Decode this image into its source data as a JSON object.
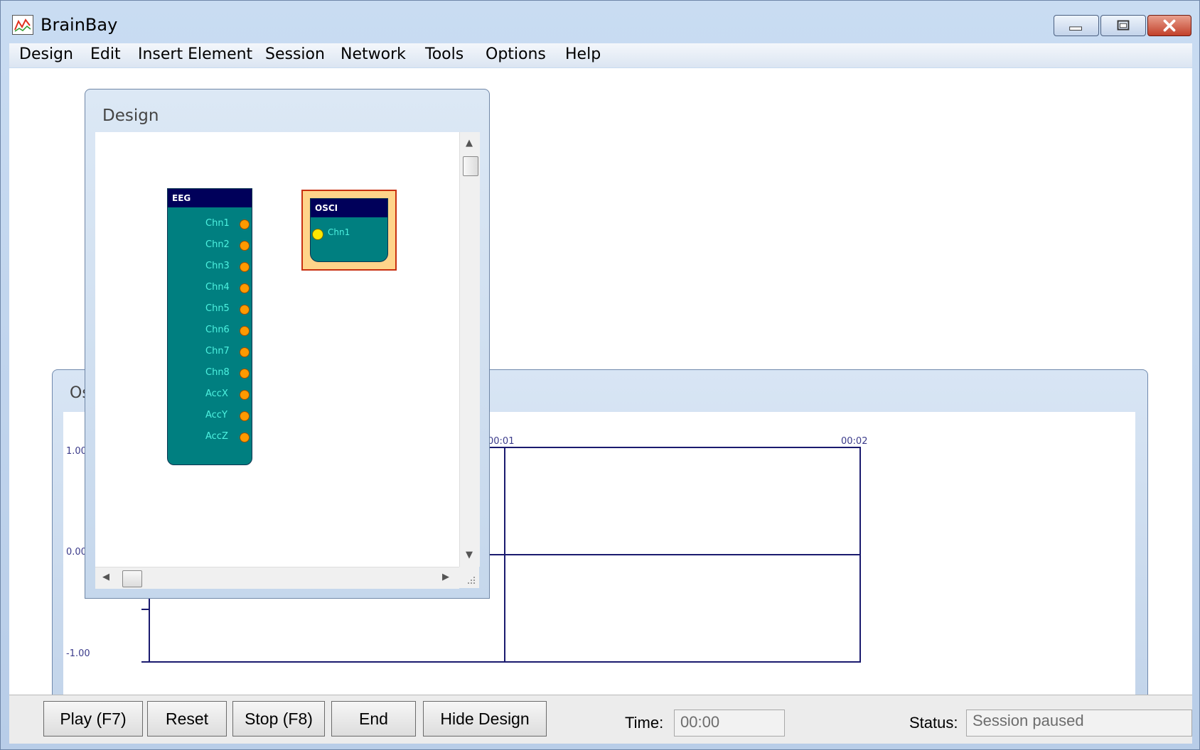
{
  "window": {
    "title": "BrainBay"
  },
  "menu": [
    "Design",
    "Edit",
    "Insert Element",
    "Session",
    "Network",
    "Tools",
    "Options",
    "Help"
  ],
  "oscilloscope": {
    "title": "Os",
    "y_labels": [
      "1.00",
      "0.00",
      "-1.00"
    ],
    "time_labels": [
      "00:01",
      "00:02"
    ]
  },
  "design": {
    "title": "Design",
    "eeg": {
      "name": "EEG",
      "ports": [
        "Chn1",
        "Chn2",
        "Chn3",
        "Chn4",
        "Chn5",
        "Chn6",
        "Chn7",
        "Chn8",
        "AccX",
        "AccY",
        "AccZ"
      ]
    },
    "osci": {
      "name": "OSCI",
      "ports": [
        "Chn1"
      ]
    }
  },
  "toolbar": {
    "play": "Play (F7)",
    "reset": "Reset",
    "stop": "Stop (F8)",
    "end": "End",
    "hide_design": "Hide Design",
    "time_label": "Time:",
    "time_value": "00:00",
    "status_label": "Status:",
    "status_value": "Session paused"
  },
  "icons": {
    "minimize": "minimize-icon",
    "maximize": "maximize-icon",
    "close": "close-icon",
    "app": "brainbay-app-icon"
  },
  "colors": {
    "module_body": "#007f80",
    "module_head": "#00005a",
    "port": "#ff9a00",
    "selected_port": "#ffe600",
    "port_text": "#4ef2e0"
  }
}
